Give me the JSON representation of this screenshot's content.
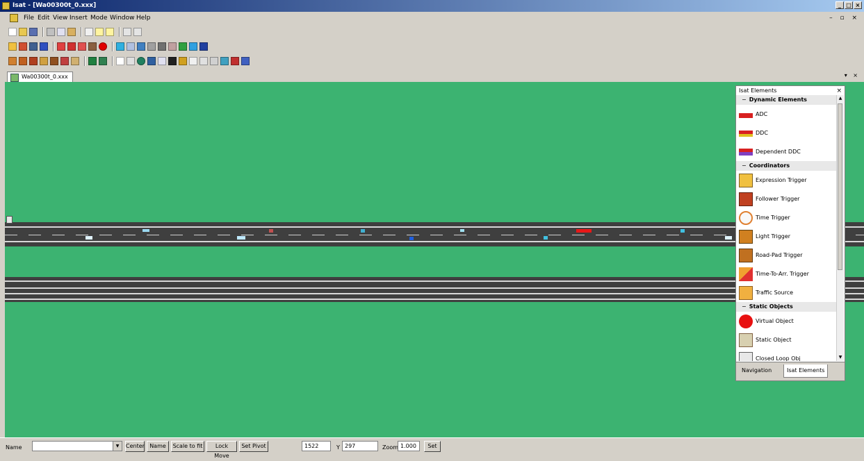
{
  "window": {
    "title": "Isat - [Wa00300t_0.xxx]",
    "min": "_",
    "max": "□",
    "close": "×"
  },
  "menu": {
    "items": [
      "File",
      "Edit",
      "View",
      "Insert",
      "Mode",
      "Window",
      "Help"
    ],
    "mdi_controls": "– ▫ ×"
  },
  "tab": {
    "label": "Wa00300t_0.xxx",
    "controls": "▾ ×"
  },
  "panel": {
    "title": "Isat Elements",
    "close": "×",
    "sections": [
      {
        "header": "Dynamic Elements",
        "items": [
          {
            "label": "ADC",
            "icon": "red-car-icon"
          },
          {
            "label": "DDC",
            "icon": "red-car-stack-icon"
          },
          {
            "label": "Dependent DDC",
            "icon": "multi-car-icon"
          }
        ]
      },
      {
        "header": "Coordinators",
        "items": [
          {
            "label": "Expression Trigger",
            "icon": "expression-icon"
          },
          {
            "label": "Follower Trigger",
            "icon": "follower-icon"
          },
          {
            "label": "Time Trigger",
            "icon": "clock-icon"
          },
          {
            "label": "Light Trigger",
            "icon": "traffic-light-icon"
          },
          {
            "label": "Road-Pad Trigger",
            "icon": "road-pad-icon"
          },
          {
            "label": "Time-To-Arr. Trigger",
            "icon": "time-to-arrival-icon"
          },
          {
            "label": "Traffic Source",
            "icon": "traffic-source-icon"
          }
        ]
      },
      {
        "header": "Static Objects",
        "items": [
          {
            "label": "Virtual Object",
            "icon": "red-circle-icon"
          },
          {
            "label": "Static Object",
            "icon": "static-object-icon"
          },
          {
            "label": "Closed Loop Obj",
            "icon": "closed-loop-icon"
          }
        ]
      }
    ],
    "tabs": [
      "Navigation",
      "Isat Elements"
    ],
    "active_tab": "Isat Elements"
  },
  "status": {
    "label_left": "Name",
    "buttons": [
      "Center",
      "Name",
      "Scale to fit",
      "Lock Move",
      "Set Pivot"
    ],
    "x_value": "1522",
    "y_label": "Y",
    "y_value": "297",
    "zoom_label": "Zoom",
    "zoom_value": "1.000",
    "set_button": "Set"
  },
  "colors": {
    "grass": "#3cb371",
    "road": "#3f3f3f",
    "title_start": "#0a246a",
    "title_end": "#a6caf0"
  }
}
